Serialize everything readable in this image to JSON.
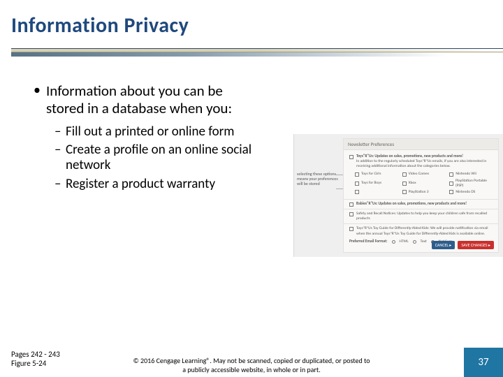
{
  "title": "Information Privacy",
  "main_bullet": "Information about you can be stored in a database when you:",
  "sub_bullets": [
    "Fill out a printed or online form",
    "Create a profile on an online social network",
    "Register a product warranty"
  ],
  "figure": {
    "panel_title": "Newsletter Preferences",
    "intro_bold": "Toys\"R\"Us: Updates on sales, promotions, new products and more!",
    "intro_text": "In addition to the regularly scheduled Toys\"R\"Us emails, if you are also interested in receiving additional information about the categories below.",
    "categories": [
      {
        "label": "Toys for Girls",
        "checked": false
      },
      {
        "label": "Video Games",
        "checked": false
      },
      {
        "label": "Nintendo Wii",
        "checked": false
      },
      {
        "label": "Toys for Boys",
        "checked": false
      },
      {
        "label": "Xbox",
        "checked": false
      },
      {
        "label": "PlayStation Portable (PSP)",
        "checked": false
      },
      {
        "label": "",
        "checked": false
      },
      {
        "label": "PlayStation 3",
        "checked": false
      },
      {
        "label": "Nintendo DS",
        "checked": false
      }
    ],
    "section2": "Babies\"R\"Us: Updates on sales, promotions, new products and more!",
    "section3": "Safety and Recall Notices: Updates to help you keep your children safe from recalled products",
    "section4": "Toys\"R\"Us Toy Guide for Differently-Abled Kids: We will provide notification via email when the annual Toys\"R\"Us Toy Guide for Differently-Abled Kids is available online.",
    "format_label": "Preferred Email Format:",
    "formats": [
      "HTML",
      "Text",
      "Not Sure"
    ],
    "cancel": "CANCEL ▸",
    "save": "SAVE CHANGES ▸",
    "annotation": "selecting these options means your preferences will be stored"
  },
  "footnote_line1": "Pages 242 - 243",
  "footnote_line2": "Figure 5-24",
  "copyright": "© 2016 Cengage Learning®. May not be scanned, copied or duplicated, or posted to a publicly accessible website, in whole or in part.",
  "page_number": "37"
}
